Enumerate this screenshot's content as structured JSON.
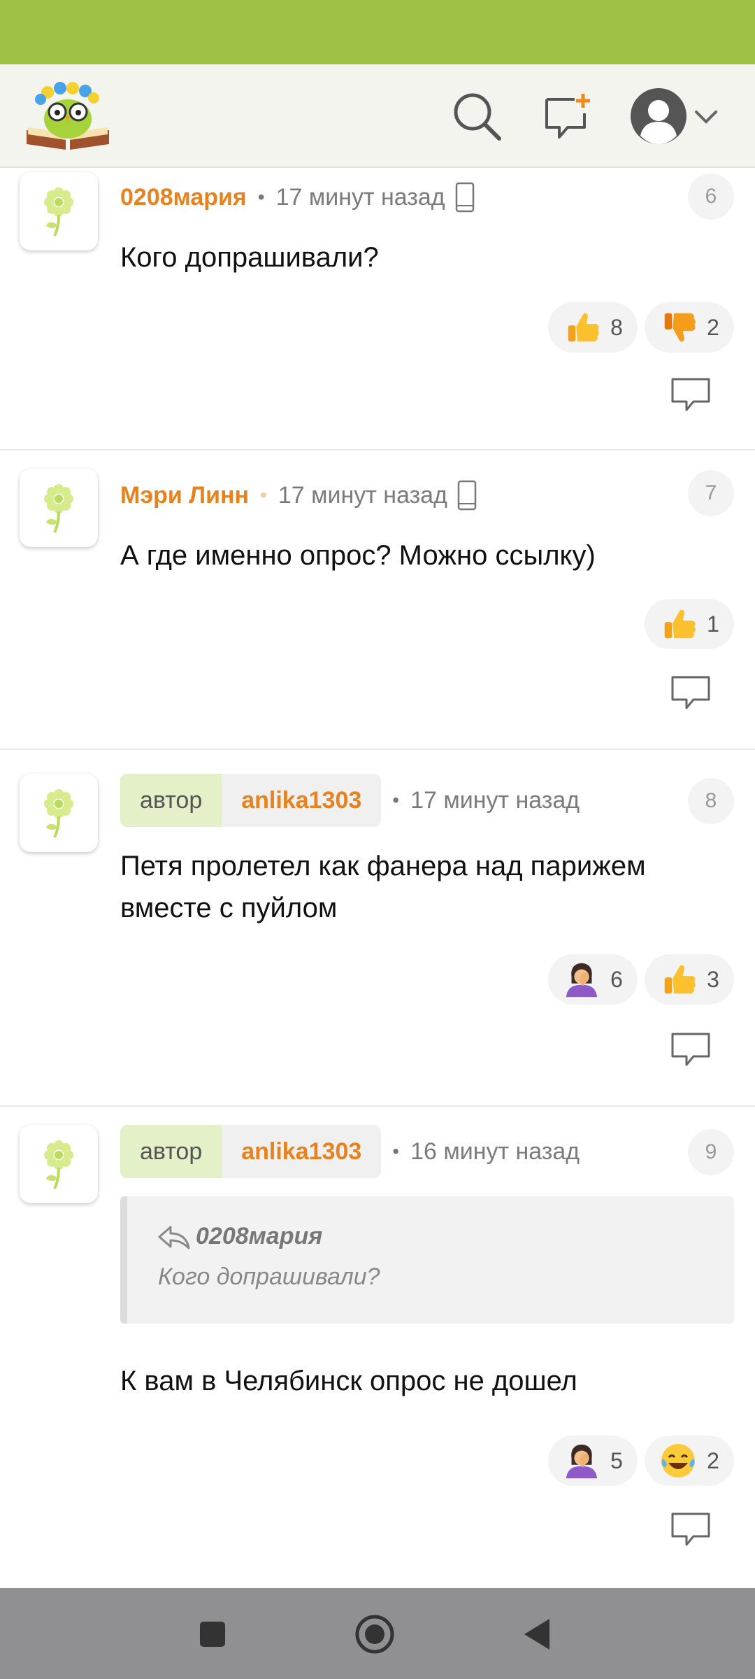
{
  "colors": {
    "status_bar": "#9fc244",
    "accent_username": "#e8821e",
    "author_tag_bg": "#e4f1c8"
  },
  "header": {
    "logo_icon": "owl-book-logo-icon",
    "search_icon": "search-icon",
    "new_post_icon": "new-comment-plus-icon",
    "profile_icon": "user-avatar-icon",
    "dropdown_icon": "chevron-down-icon"
  },
  "comments": [
    {
      "username": "0208мария",
      "time": "17 минут назад",
      "number": "6",
      "text": "Кого допрашивали?",
      "reactions": [
        {
          "emoji": "thumbs-up",
          "count": "8"
        },
        {
          "emoji": "thumbs-down",
          "count": "2"
        }
      ]
    },
    {
      "username": "Мэри Линн",
      "time": "17 минут назад",
      "number": "7",
      "text": "А где именно опрос? Можно ссылку)",
      "reactions": [
        {
          "emoji": "thumbs-up",
          "count": "1"
        }
      ]
    },
    {
      "author_tag": "автор",
      "username": "anlika1303",
      "time": "17 минут назад",
      "number": "8",
      "text_line1": "Петя пролетел как фанера над парижем",
      "text_line2": "вместе с пуйлом",
      "reactions": [
        {
          "emoji": "facepalm",
          "count": "6"
        },
        {
          "emoji": "thumbs-up",
          "count": "3"
        }
      ]
    },
    {
      "author_tag": "автор",
      "username": "anlika1303",
      "time": "16 минут назад",
      "number": "9",
      "quote_author": "0208мария",
      "quote_text": "Кого допрашивали?",
      "text": "К вам в Челябинск опрос не дошел",
      "reactions": [
        {
          "emoji": "facepalm",
          "count": "5"
        },
        {
          "emoji": "laughing-tears",
          "count": "2"
        }
      ]
    }
  ],
  "navbar": {
    "recents_icon": "square-icon",
    "home_icon": "circle-icon",
    "back_icon": "triangle-back-icon"
  }
}
